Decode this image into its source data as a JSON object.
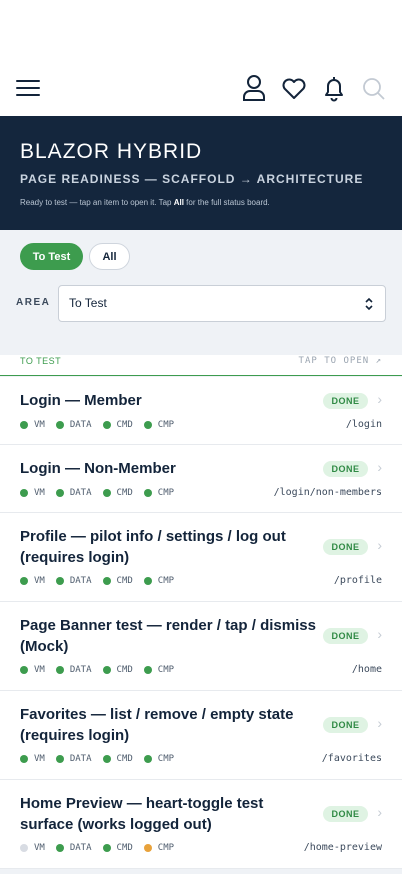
{
  "colors": {
    "navy": "#14263d",
    "green": "#3d9c4e",
    "orange": "#e8a23b",
    "grey": "#d8dce3"
  },
  "header": {
    "menu_icon": "hamburger-icon",
    "icons": [
      "user-icon",
      "heart-icon",
      "bell-icon",
      "search-icon"
    ]
  },
  "hero": {
    "title": "BLAZOR HYBRID",
    "subtitle": "PAGE READINESS — SCAFFOLD → ARCHITECTURE",
    "note_pre": "Ready to test — tap an item to open it. Tap ",
    "note_bold": "All",
    "note_post": " for the full status board."
  },
  "filters": {
    "tabs": [
      {
        "label": "To Test",
        "active": true
      },
      {
        "label": "All",
        "active": false
      }
    ],
    "area_label": "AREA",
    "area_value": "To Test"
  },
  "section": {
    "left": "TO TEST",
    "right": "TAP TO OPEN ↗"
  },
  "items": [
    {
      "title": "Login — Member",
      "status": "DONE",
      "path": "/login",
      "tags": [
        {
          "label": "VM",
          "state": "green"
        },
        {
          "label": "DATA",
          "state": "green"
        },
        {
          "label": "CMD",
          "state": "green"
        },
        {
          "label": "CMP",
          "state": "green"
        }
      ]
    },
    {
      "title": "Login — Non-Member",
      "status": "DONE",
      "path": "/login/non-members",
      "tags": [
        {
          "label": "VM",
          "state": "green"
        },
        {
          "label": "DATA",
          "state": "green"
        },
        {
          "label": "CMD",
          "state": "green"
        },
        {
          "label": "CMP",
          "state": "green"
        }
      ]
    },
    {
      "title": "Profile — pilot info / settings / log out (requires login)",
      "status": "DONE",
      "path": "/profile",
      "tags": [
        {
          "label": "VM",
          "state": "green"
        },
        {
          "label": "DATA",
          "state": "green"
        },
        {
          "label": "CMD",
          "state": "green"
        },
        {
          "label": "CMP",
          "state": "green"
        }
      ]
    },
    {
      "title": "Page Banner test — render / tap / dismiss (Mock)",
      "status": "DONE",
      "path": "/home",
      "tags": [
        {
          "label": "VM",
          "state": "green"
        },
        {
          "label": "DATA",
          "state": "green"
        },
        {
          "label": "CMD",
          "state": "green"
        },
        {
          "label": "CMP",
          "state": "green"
        }
      ]
    },
    {
      "title": "Favorites — list / remove / empty state (requires login)",
      "status": "DONE",
      "path": "/favorites",
      "tags": [
        {
          "label": "VM",
          "state": "green"
        },
        {
          "label": "DATA",
          "state": "green"
        },
        {
          "label": "CMD",
          "state": "green"
        },
        {
          "label": "CMP",
          "state": "green"
        }
      ]
    },
    {
      "title": "Home Preview — heart-toggle test surface (works logged out)",
      "status": "DONE",
      "path": "/home-preview",
      "tags": [
        {
          "label": "VM",
          "state": "grey"
        },
        {
          "label": "DATA",
          "state": "green"
        },
        {
          "label": "CMD",
          "state": "green"
        },
        {
          "label": "CMP",
          "state": "orange"
        }
      ]
    }
  ]
}
